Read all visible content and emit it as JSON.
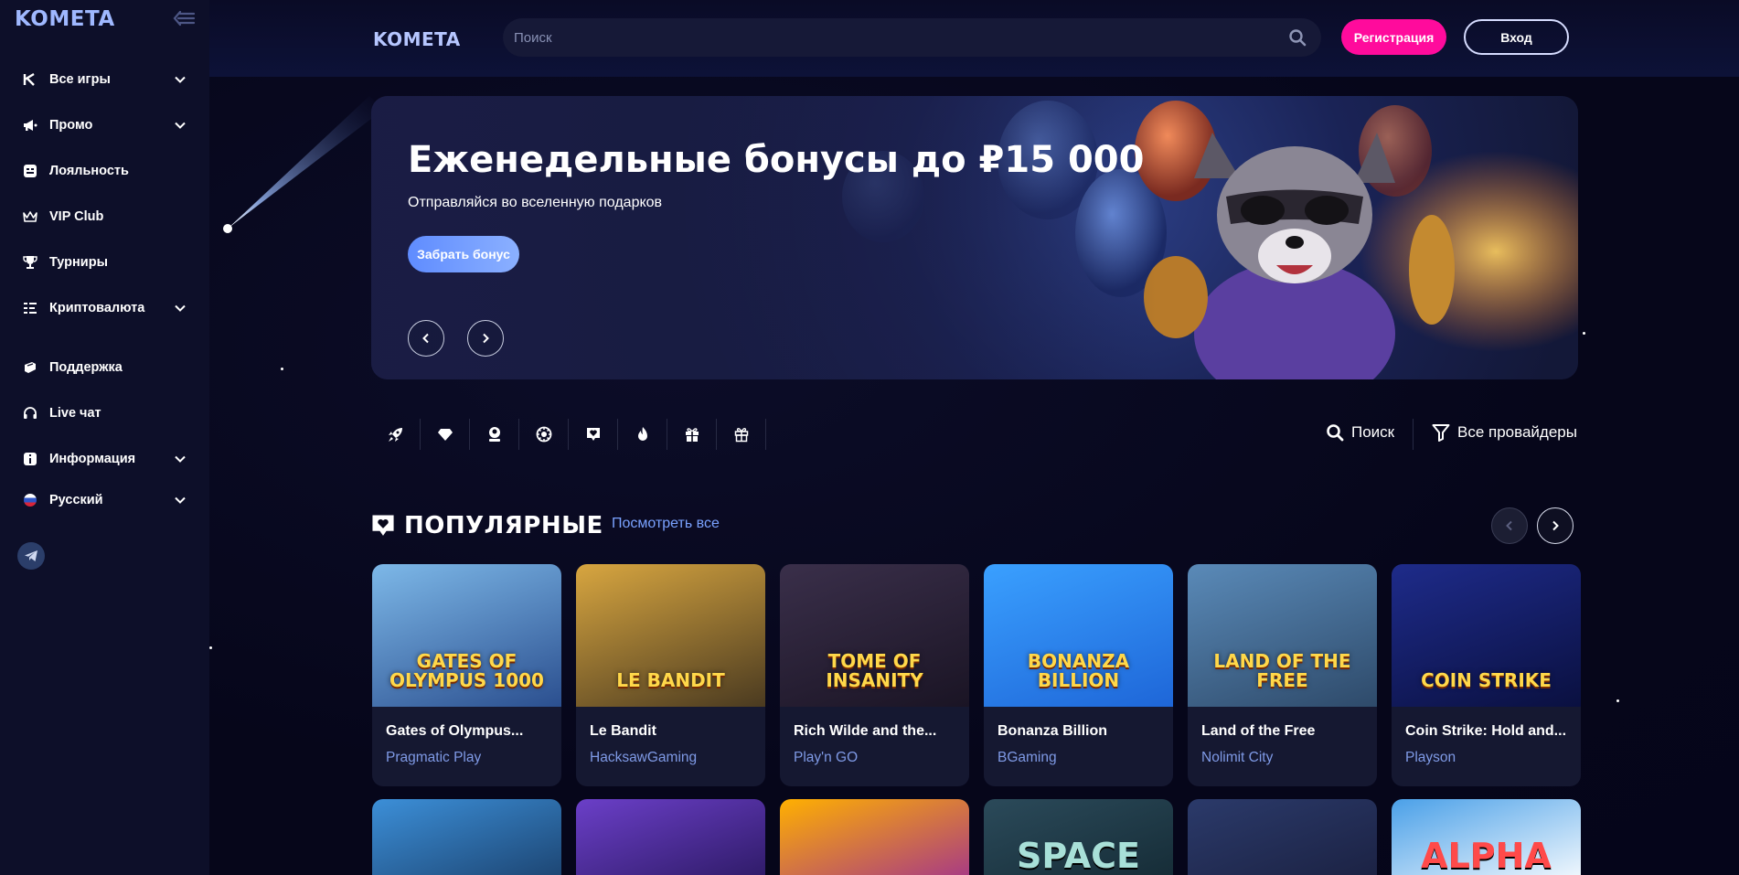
{
  "sidebar": {
    "logo": "KOMETA",
    "items": [
      {
        "label": "Все игры",
        "icon": "kometa-k-icon",
        "expandable": true
      },
      {
        "label": "Промо",
        "icon": "megaphone-icon",
        "expandable": true
      },
      {
        "label": "Лояльность",
        "icon": "loyalty-card-icon",
        "expandable": false
      },
      {
        "label": "VIP Club",
        "icon": "crown-icon",
        "expandable": false
      },
      {
        "label": "Турниры",
        "icon": "trophy-icon",
        "expandable": false
      },
      {
        "label": "Криптовалюта",
        "icon": "crypto-icon",
        "expandable": true
      },
      {
        "label": "Поддержка",
        "icon": "support-icon",
        "expandable": false
      },
      {
        "label": "Live чат",
        "icon": "headset-icon",
        "expandable": false
      },
      {
        "label": "Информация",
        "icon": "info-icon",
        "expandable": true
      },
      {
        "label": "Русский",
        "icon": "russia-flag-icon",
        "expandable": true
      }
    ],
    "telegram_icon": "telegram-icon"
  },
  "header": {
    "logo": "KOMETA",
    "search_placeholder": "Поиск",
    "register_label": "Регистрация",
    "login_label": "Вход"
  },
  "banner": {
    "title": "Еженедельные бонусы до ₽15 000",
    "subtitle": "Отправляйся во вселенную подарков",
    "button_label": "Забрать бонус"
  },
  "categories": [
    {
      "icon": "rocket-icon"
    },
    {
      "icon": "diamond-icon"
    },
    {
      "icon": "live-dealer-icon"
    },
    {
      "icon": "roulette-icon"
    },
    {
      "icon": "heart-badge-icon"
    },
    {
      "icon": "fire-icon"
    },
    {
      "icon": "gift-box-icon"
    },
    {
      "icon": "gift-icon"
    }
  ],
  "filters": {
    "search_label": "Поиск",
    "providers_label": "Все провайдеры"
  },
  "popular": {
    "title": "ПОПУЛЯРНЫЕ",
    "see_all": "Посмотреть все",
    "games": [
      {
        "name": "Gates of Olympus...",
        "provider": "Pragmatic Play",
        "art_text": "GATES OF OLYMPUS 1000",
        "colors": [
          "#7db8e8",
          "#2b4f8f"
        ]
      },
      {
        "name": "Le Bandit",
        "provider": "HacksawGaming",
        "art_text": "LE BANDIT",
        "colors": [
          "#d8a640",
          "#4a3a20"
        ]
      },
      {
        "name": "Rich Wilde and the...",
        "provider": "Play'n GO",
        "art_text": "TOME OF INSANITY",
        "colors": [
          "#3a2f4a",
          "#1a1424"
        ]
      },
      {
        "name": "Bonanza Billion",
        "provider": "BGaming",
        "art_text": "BONANZA BILLION",
        "colors": [
          "#3aa0ff",
          "#1e66d8"
        ]
      },
      {
        "name": "Land of the Free",
        "provider": "Nolimit City",
        "art_text": "LAND OF THE FREE",
        "colors": [
          "#5a8ab8",
          "#2e4a6a"
        ]
      },
      {
        "name": "Coin Strike: Hold and...",
        "provider": "Playson",
        "art_text": "COIN STRIKE",
        "colors": [
          "#1e2b8a",
          "#0a1040"
        ]
      }
    ],
    "second_row": [
      {
        "colors": [
          "#3c8fd8",
          "#1a3f6a"
        ]
      },
      {
        "colors": [
          "#6b3fc8",
          "#2a1860"
        ]
      },
      {
        "colors": [
          "#ffb000",
          "#a03090"
        ]
      },
      {
        "colors": [
          "#2b4a5a",
          "#142a34"
        ],
        "art_text": "SPACE"
      },
      {
        "colors": [
          "#2b3a6a",
          "#1a2040"
        ]
      },
      {
        "colors": [
          "#4aa0e8",
          "#ffffff"
        ],
        "art_text": "ALPHA"
      }
    ]
  },
  "chat_icon": "chat-bubble-icon"
}
